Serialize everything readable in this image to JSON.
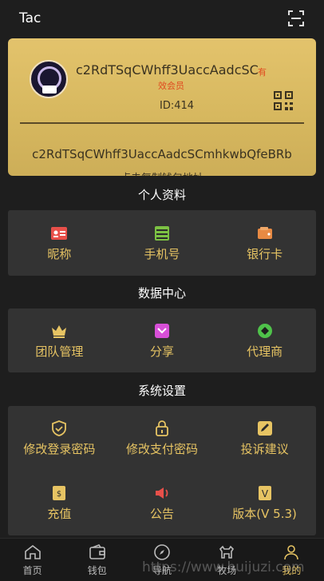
{
  "header": {
    "title": "Tac",
    "scan_icon": "scan-icon"
  },
  "card": {
    "address_short": "c2RdTSqCWhff3UaccAadcSC",
    "member_part1": "有",
    "member_part2": "效会员",
    "id": "ID:414",
    "address_full": "c2RdTSqCWhff3UaccAadcSCmhkwbQfeBRb",
    "copy_hint": "点击复制钱包地址"
  },
  "profile": {
    "title": "个人资料",
    "items": [
      {
        "label": "昵称",
        "icon": "id-card-icon",
        "color": "#e8504a"
      },
      {
        "label": "手机号",
        "icon": "phone-icon",
        "color": "#7cc243"
      },
      {
        "label": "银行卡",
        "icon": "wallet-icon",
        "color": "#e88a43"
      }
    ]
  },
  "data_center": {
    "title": "数据中心",
    "items": [
      {
        "label": "团队管理",
        "icon": "crown-icon",
        "color": "#e7c463"
      },
      {
        "label": "分享",
        "icon": "share-icon",
        "color": "#d84fd8"
      },
      {
        "label": "代理商",
        "icon": "diamond-icon",
        "color": "#4fc24a"
      }
    ]
  },
  "settings": {
    "title": "系统设置",
    "items": [
      {
        "label": "修改登录密码",
        "icon": "shield-icon",
        "color": "#e7c463"
      },
      {
        "label": "修改支付密码",
        "icon": "lock-icon",
        "color": "#e7c463"
      },
      {
        "label": "投诉建议",
        "icon": "edit-icon",
        "color": "#e7c463"
      },
      {
        "label": "充值",
        "icon": "recharge-icon",
        "color": "#e7c463"
      },
      {
        "label": "公告",
        "icon": "speaker-icon",
        "color": "#e8504a"
      },
      {
        "label": "版本(V 5.3)",
        "icon": "version-icon",
        "color": "#e7c463"
      }
    ]
  },
  "tabbar": [
    {
      "label": "首页",
      "icon": "home-icon"
    },
    {
      "label": "钱包",
      "icon": "wallet-tab-icon"
    },
    {
      "label": "导航",
      "icon": "compass-icon"
    },
    {
      "label": "牧场",
      "icon": "farm-icon"
    },
    {
      "label": "我的",
      "icon": "user-icon"
    }
  ],
  "watermark": "https://www.huijuzi.com",
  "colors": {
    "accent": "#e7c463",
    "card": "#d7b85f",
    "background": "#1e1e1e",
    "panel": "#333333"
  }
}
